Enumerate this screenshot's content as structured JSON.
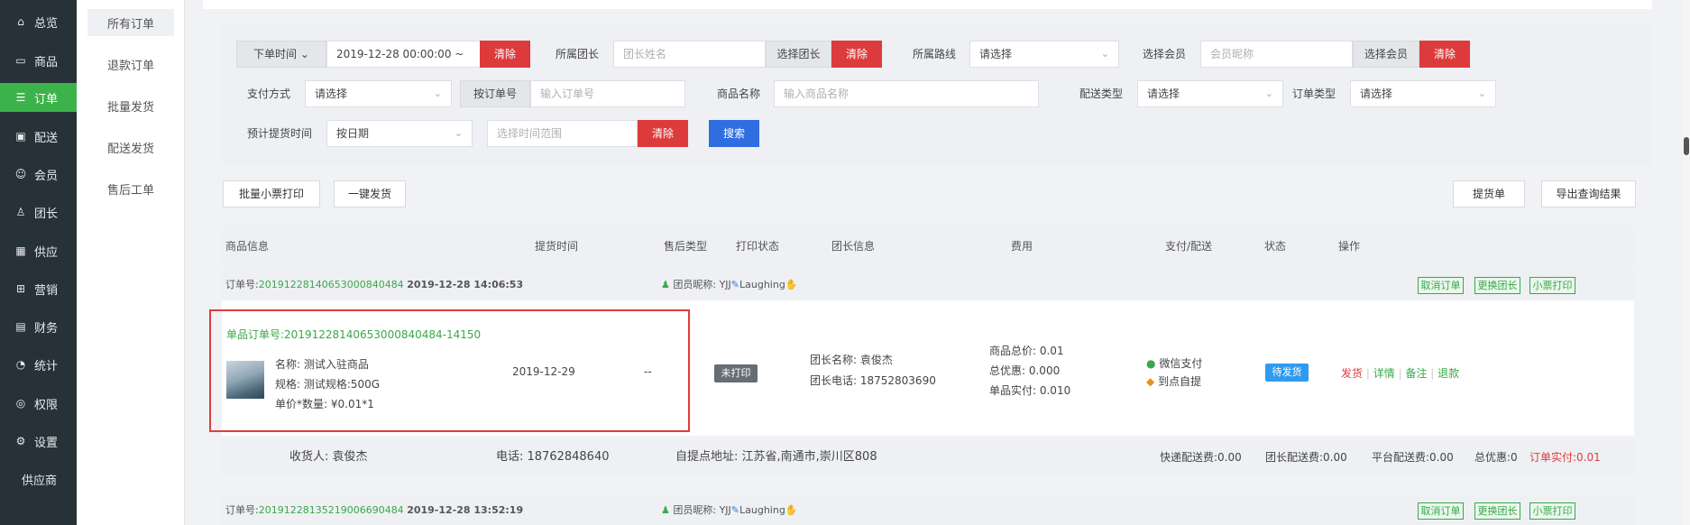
{
  "nav": {
    "items": [
      {
        "label": "总览",
        "icon": "home-icon"
      },
      {
        "label": "商品",
        "icon": "shop-icon"
      },
      {
        "label": "订单",
        "icon": "order-icon"
      },
      {
        "label": "配送",
        "icon": "delivery-icon"
      },
      {
        "label": "会员",
        "icon": "user-icon"
      },
      {
        "label": "团长",
        "icon": "leader-icon"
      },
      {
        "label": "供应",
        "icon": "supply-icon"
      },
      {
        "label": "营销",
        "icon": "marketing-icon"
      },
      {
        "label": "财务",
        "icon": "finance-icon"
      },
      {
        "label": "统计",
        "icon": "stats-icon"
      },
      {
        "label": "权限",
        "icon": "permission-icon"
      },
      {
        "label": "设置",
        "icon": "settings-icon"
      },
      {
        "label": "供应商",
        "icon": ""
      }
    ]
  },
  "subnav": {
    "items": [
      "所有订单",
      "退款订单",
      "批量发货",
      "配送发货",
      "售后工单"
    ]
  },
  "filter": {
    "order_time_label": "下单时间",
    "order_time_value": "2019-12-28 00:00:00 ~",
    "clear": "清除",
    "leader_label": "所属团长",
    "leader_placeholder": "团长姓名",
    "select_leader": "选择团长",
    "route_label": "所属路线",
    "route_value": "请选择",
    "member_label": "选择会员",
    "member_placeholder": "会员昵称",
    "select_member": "选择会员",
    "pay_label": "支付方式",
    "pay_value": "请选择",
    "by_order_no": "按订单号",
    "order_no_placeholder": "输入订单号",
    "goods_name_label": "商品名称",
    "goods_name_placeholder": "输入商品名称",
    "delivery_type_label": "配送类型",
    "delivery_type_value": "请选择",
    "order_type_label": "订单类型",
    "order_type_value": "请选择",
    "pickup_time_label": "预计提货时间",
    "pickup_time_value": "按日期",
    "time_range_placeholder": "选择时间范围",
    "search": "搜索"
  },
  "actions": {
    "batch_print": "批量小票打印",
    "batch_ship": "一键发货",
    "pickup_note": "提货单",
    "export": "导出查询结果"
  },
  "table": {
    "headers": [
      "商品信息",
      "提货时间",
      "售后类型",
      "打印状态",
      "团长信息",
      "费用",
      "支付/配送",
      "状态",
      "操作"
    ]
  },
  "order1": {
    "order_no_label": "订单号:",
    "order_no": "20191228140653000840484",
    "created": "2019-12-28 14:06:53",
    "member_label": "团员昵称: YJJ",
    "member_name": "Laughing",
    "btn_cancel": "取消订单",
    "btn_change_leader": "更换团长",
    "btn_print": "小票打印",
    "item_no_label": "单品订单号:",
    "item_no": "20191228140653000840484-14150",
    "name_label": "名称: 测试入驻商品",
    "spec_label": "规格: 测试规格:500G",
    "price_label": "单价*数量: ¥0.01*1",
    "pickup_date": "2019-12-29",
    "after_sale": "--",
    "print_status": "未打印",
    "leader_name": "团长名称: 袁俊杰",
    "leader_phone": "团长电话: 18752803690",
    "goods_total": "商品总价: 0.01",
    "discount": "总优惠: 0.000",
    "paid": "单品实付: 0.010",
    "pay_method": "微信支付",
    "delivery_method": "到点自提",
    "status": "待发货",
    "op_ship": "发货",
    "op_detail": "详情",
    "op_note": "备注",
    "op_refund": "退款",
    "receiver": "收货人: 袁俊杰",
    "phone": "电话: 18762848640",
    "address": "自提点地址: 江苏省,南通市,崇川区808",
    "express_fee": "快递配送费:0.00",
    "leader_fee": "团长配送费:0.00",
    "platform_fee": "平台配送费:0.00",
    "total_discount": "总优惠:0",
    "order_paid": "订单实付:0.01"
  },
  "order2": {
    "order_no_label": "订单号:",
    "order_no": "20191228135219006690484",
    "created": "2019-12-28 13:52:19",
    "member_label": "团员昵称: YJJ",
    "member_name": "Laughing",
    "btn_cancel": "取消订单",
    "btn_change_leader": "更换团长",
    "btn_print": "小票打印"
  },
  "colors": {
    "nav_bg": "#263238",
    "accent_green": "#3cb34a",
    "danger": "#dd3b3b",
    "primary": "#2f6ee0"
  }
}
